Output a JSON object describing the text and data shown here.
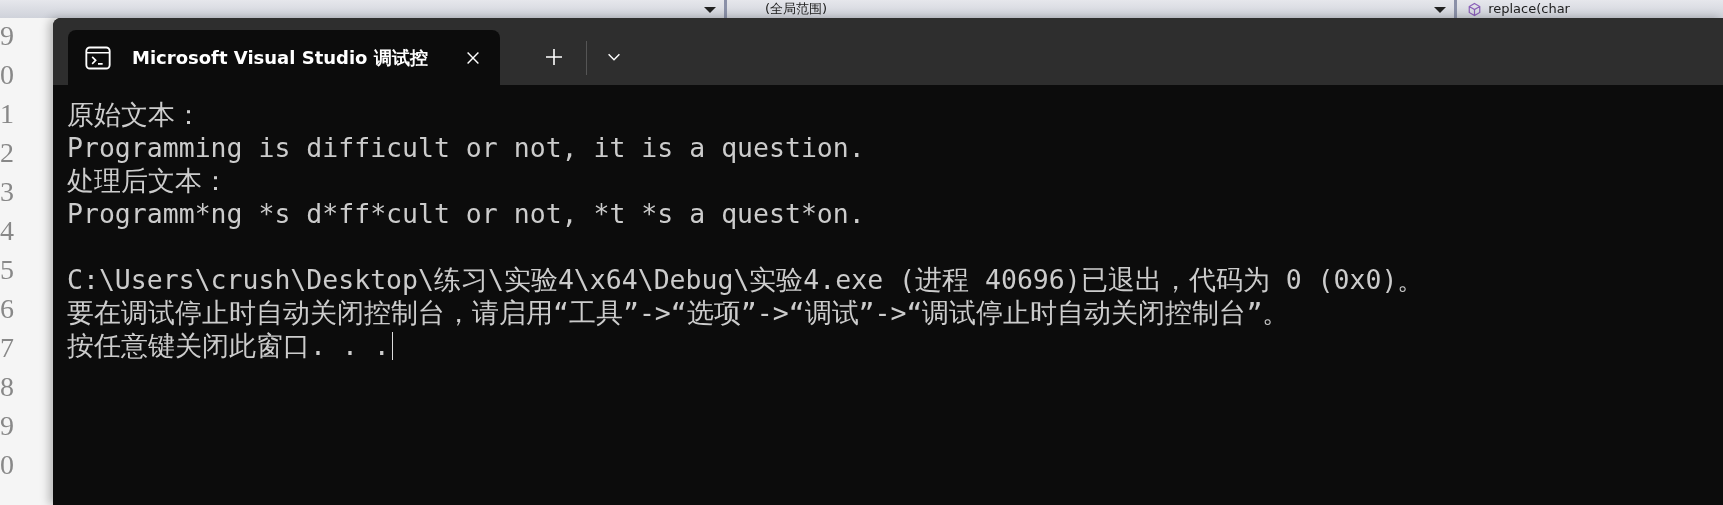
{
  "editor": {
    "scope_dropdown": "(全局范围)",
    "member_dropdown": "replace(char",
    "line_numbers": [
      "9",
      "0",
      "1",
      "2",
      "3",
      "4",
      "5",
      "6",
      "7",
      "8",
      "9",
      "0"
    ]
  },
  "terminal": {
    "tab": {
      "title": "Microsoft Visual Studio 调试控",
      "selected": true
    },
    "output_lines": [
      "原始文本：",
      "Programming is difficult or not, it is a question.",
      "处理后文本：",
      "Programm*ng *s d*ff*cult or not, *t *s a quest*on."
    ],
    "exit_lines": [
      "C:\\Users\\crush\\Desktop\\练习\\实验4\\x64\\Debug\\实验4.exe (进程 40696)已退出，代码为 0 (0x0)。",
      "要在调试停止时自动关闭控制台，请启用“工具”->“选项”->“调试”->“调试停止时自动关闭控制台”。",
      "按任意键关闭此窗口. . ."
    ]
  }
}
